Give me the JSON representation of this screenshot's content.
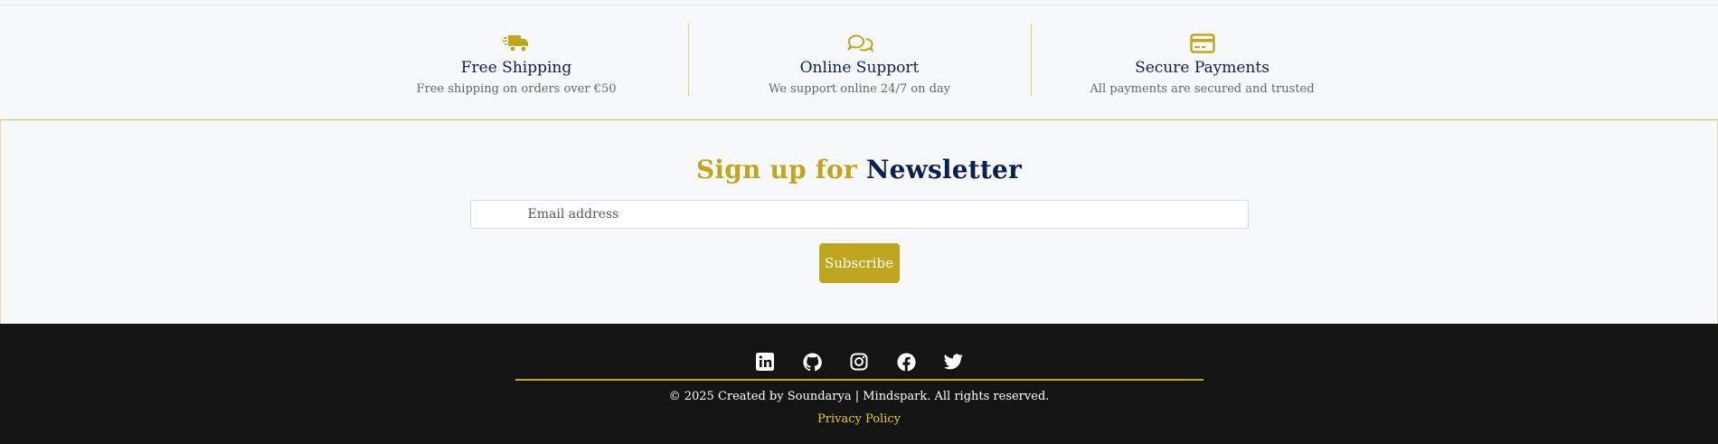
{
  "features": [
    {
      "icon": "truck-icon",
      "title": "Free Shipping",
      "desc": "Free shipping on orders over €50"
    },
    {
      "icon": "chat-bubbles-icon",
      "title": "Online Support",
      "desc": "We support online 24/7 on day"
    },
    {
      "icon": "credit-card-icon",
      "title": "Secure Payments",
      "desc": "All payments are secured and trusted"
    }
  ],
  "newsletter": {
    "title_part1": "Sign up for",
    "title_part2": "Newsletter",
    "email_placeholder": "Email address",
    "subscribe_label": "Subscribe"
  },
  "footer": {
    "socials": [
      "linkedin-icon",
      "github-icon",
      "instagram-icon",
      "facebook-icon",
      "twitter-icon"
    ],
    "copyright": "© 2025 Created by Soundarya | Mindspark. All rights reserved.",
    "privacy_label": "Privacy Policy"
  },
  "colors": {
    "accent_gold": "#c0a521",
    "navy": "#0c1f4f",
    "footer_bg": "#141414",
    "page_bg": "#f7f8f9"
  }
}
